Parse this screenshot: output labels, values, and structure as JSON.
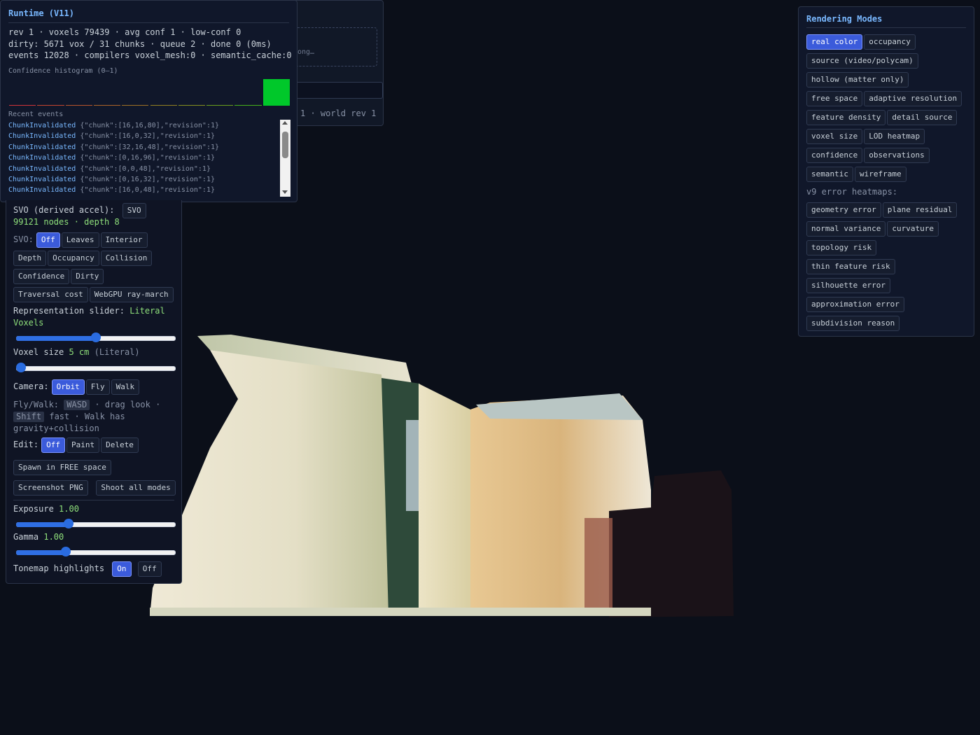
{
  "runtime": {
    "title": "Runtime (V11)",
    "line1": "rev 1 · voxels 79439 · avg conf 1 · low-conf 0",
    "line2": "dirty: 5671 vox / 31 chunks · queue 2 · done 0 (0ms)",
    "line3": "events 12028 · compilers voxel_mesh:0 · semantic_cache:0",
    "histogram_label": "Confidence histogram (0–1)",
    "histogram": [
      0,
      0,
      0,
      0,
      0,
      0,
      0,
      0,
      0,
      1
    ],
    "histogram_colors": [
      "#d0343a",
      "#c5452f",
      "#b9542c",
      "#ad6329",
      "#a07225",
      "#938122",
      "#86901f",
      "#6a9f1c",
      "#47b01a",
      "#00c82a"
    ],
    "events_label": "Recent events",
    "events": [
      {
        "name": "ChunkInvalidated",
        "payload": "{\"chunk\":[16,16,80],\"revision\":1}"
      },
      {
        "name": "ChunkInvalidated",
        "payload": "{\"chunk\":[16,0,32],\"revision\":1}"
      },
      {
        "name": "ChunkInvalidated",
        "payload": "{\"chunk\":[32,16,48],\"revision\":1}"
      },
      {
        "name": "ChunkInvalidated",
        "payload": "{\"chunk\":[0,16,96],\"revision\":1}"
      },
      {
        "name": "ChunkInvalidated",
        "payload": "{\"chunk\":[0,0,48],\"revision\":1}"
      },
      {
        "name": "ChunkInvalidated",
        "payload": "{\"chunk\":[0,16,32],\"revision\":1}"
      },
      {
        "name": "ChunkInvalidated",
        "payload": "{\"chunk\":[16,0,48],\"revision\":1}"
      }
    ]
  },
  "behind_panel": {
    "drop_hint": "ong…",
    "world_rev": "1 · world rev 1"
  },
  "controls": {
    "svo_label": "SVO (derived accel):",
    "svo_button": "SVO",
    "svo_stats": "99121 nodes · depth 8",
    "svo_mode_label": "SVO:",
    "svo_modes": [
      "Off",
      "Leaves",
      "Interior",
      "Depth",
      "Occupancy",
      "Collision",
      "Confidence",
      "Dirty",
      "Traversal cost",
      "WebGPU ray-march"
    ],
    "svo_active": "Off",
    "rep_label": "Representation slider:",
    "rep_value": "Literal Voxels",
    "rep_slider": 0.5,
    "voxel_label": "Voxel size",
    "voxel_value": "5 cm",
    "voxel_mode": "(Literal)",
    "voxel_slider": 0.0,
    "camera_label": "Camera:",
    "camera_modes": [
      "Orbit",
      "Fly",
      "Walk"
    ],
    "camera_active": "Orbit",
    "help_prefix": "Fly/Walk:",
    "help_key1": "WASD",
    "help_mid": "· drag look ·",
    "help_key2": "Shift",
    "help_suffix": "fast · Walk has gravity+collision",
    "edit_label": "Edit:",
    "edit_modes": [
      "Off",
      "Paint",
      "Delete"
    ],
    "edit_active": "Off",
    "spawn_button": "Spawn in FREE space",
    "screenshot_button": "Screenshot PNG",
    "shoot_button": "Shoot all modes",
    "exposure_label": "Exposure",
    "exposure_value": "1.00",
    "exposure_slider": 0.32,
    "gamma_label": "Gamma",
    "gamma_value": "1.00",
    "gamma_slider": 0.3,
    "tonemap_label": "Tonemap highlights",
    "tonemap_on": "On",
    "tonemap_off": "Off"
  },
  "rendering": {
    "title": "Rendering Modes",
    "modes": [
      [
        "real color",
        "occupancy"
      ],
      [
        "source (video/polycam)"
      ],
      [
        "hollow (matter only)"
      ],
      [
        "free space",
        "adaptive resolution"
      ],
      [
        "feature density",
        "detail source"
      ],
      [
        "voxel size",
        "LOD heatmap"
      ],
      [
        "confidence",
        "observations"
      ],
      [
        "semantic",
        "wireframe"
      ]
    ],
    "active": "real color",
    "heatmaps_label": "v9 error heatmaps:",
    "heatmaps": [
      [
        "geometry error",
        "plane residual"
      ],
      [
        "normal variance",
        "curvature"
      ],
      [
        "topology risk"
      ],
      [
        "thin feature risk"
      ],
      [
        "silhouette error"
      ],
      [
        "approximation error"
      ],
      [
        "subdivision reason"
      ]
    ]
  }
}
